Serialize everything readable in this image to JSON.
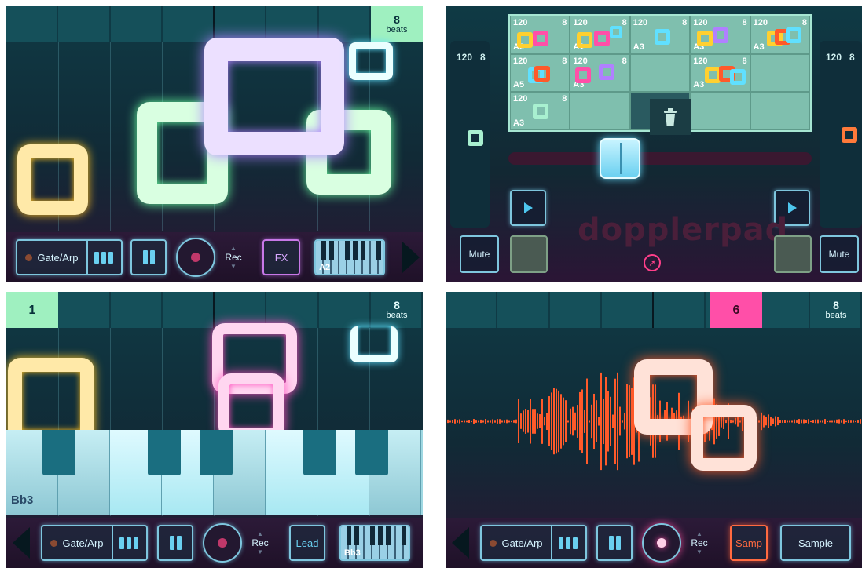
{
  "panel1": {
    "beats_count": "8",
    "beats_label": "beats",
    "toolbar": {
      "mode_label": "Gate/Arp",
      "rec_label": "Rec",
      "fx_label": "FX",
      "keys_note": "A2"
    }
  },
  "panel2": {
    "left_tempo": "120",
    "left_beats": "8",
    "right_tempo": "120",
    "right_beats": "8",
    "grid": [
      [
        {
          "tempo": "120",
          "beats": "8",
          "note": "A2"
        },
        {
          "tempo": "120",
          "beats": "8",
          "note": "A1"
        },
        {
          "tempo": "120",
          "beats": "8",
          "note": "A3"
        },
        {
          "tempo": "120",
          "beats": "8",
          "note": "A3"
        },
        {
          "tempo": "120",
          "beats": "8",
          "note": "A3"
        }
      ],
      [
        {
          "tempo": "120",
          "beats": "8",
          "note": "A5"
        },
        {
          "tempo": "120",
          "beats": "8",
          "note": "A3"
        },
        {
          "tempo": "",
          "beats": "",
          "note": ""
        },
        {
          "tempo": "120",
          "beats": "8",
          "note": "A3"
        },
        {
          "tempo": "",
          "beats": "",
          "note": ""
        }
      ],
      [
        {
          "tempo": "120",
          "beats": "8",
          "note": "A3"
        },
        {
          "tempo": "",
          "beats": "",
          "note": ""
        },
        {
          "tempo": "",
          "beats": "",
          "note": ""
        },
        {
          "tempo": "",
          "beats": "",
          "note": ""
        },
        {
          "tempo": "",
          "beats": "",
          "note": ""
        }
      ]
    ],
    "logo": "dopplerpad",
    "mute_left": "Mute",
    "mute_right": "Mute"
  },
  "panel3": {
    "beat_number": "1",
    "beats_count": "8",
    "beats_label": "beats",
    "keyboard_note": "Bb3",
    "toolbar": {
      "mode_label": "Gate/Arp",
      "rec_label": "Rec",
      "instrument_label": "Lead",
      "keys_note": "Bb3"
    }
  },
  "panel4": {
    "beat_number": "6",
    "beats_count": "8",
    "beats_label": "beats",
    "toolbar": {
      "mode_label": "Gate/Arp",
      "rec_label": "Rec",
      "samp_label": "Samp",
      "sample_label": "Sample"
    }
  },
  "colors": {
    "accent_cyan": "#7ec6de",
    "beat_badge_green": "#9ff0c0",
    "beat_badge_pink": "#ff4fa8",
    "waveform": "#ff5a2a"
  }
}
